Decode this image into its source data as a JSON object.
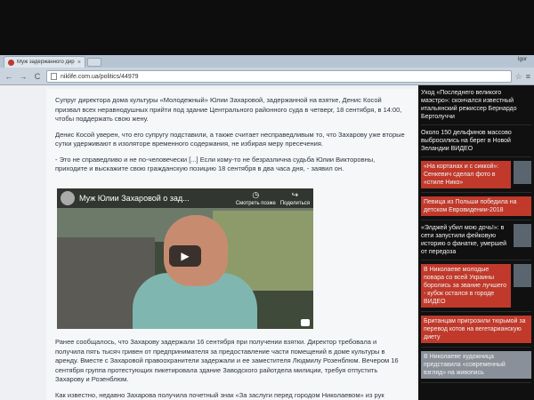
{
  "browser": {
    "tab_title": "Муж задержанного директ",
    "tab_close": "×",
    "user": "Igor",
    "url": "niklife.com.ua/politics/44979",
    "back": "←",
    "forward": "→",
    "reload": "C",
    "star": "☆",
    "menu": "≡"
  },
  "article": {
    "paragraphs": [
      "Супруг директора дома культуры «Молодежный» Юлии Захаровой, задержанной на взятке, Денис Косой призвал всех неравнодушных прийти под здание Центрального районного суда в четверг, 18 сентября, в 14:00, чтобы поддержать свою жену.",
      "Денис Косой уверен, что его супругу подставили, а также считает несправедливым то, что Захарову уже вторые сутки удерживают в изоляторе временного содержания, не избирая меру пресечения.",
      "- Это не справедливо и не по-человечески [...] Если кому-то не безразлична судьба Юлии Викторовны, приходите и выскажите свою гражданскую позицию 18 сентября в два часа дня, - заявил он."
    ],
    "after_paragraphs": [
      "Ранее сообщалось, что Захарову задержали 16 сентября при получении взятки. Директор требовала и получила пять тысяч гривен от предпринимателя за предоставление части помещений в доме культуры в аренду. Вместе с Захаровой правоохранители задержали и ее заместителя Людмилу Розенблюм. Вечером 16 сентября группа протестующих пикетировала здание Заводского райотдела милиции, требуя отпустить Захарову и Розенблюм.",
      "Как известно, недавно Захарова получила почетный знак «За заслуги перед городом Николаевом» из рук"
    ]
  },
  "video": {
    "title": "Муж Юлии Захаровой о зад...",
    "watch_later": "Смотреть позже",
    "share": "Поделиться",
    "play": "▶"
  },
  "sidebar": {
    "items": [
      {
        "text": "Уход «Последнего великого маэстро»: скончался известный итальянский режиссер Бернардо Бертолуччи",
        "style": "plain"
      },
      {
        "text": "Около 150 дельфинов массово выбросились на берег в Новой Зеландии ВИДЕО",
        "style": "plain"
      },
      {
        "text": "«На кортанах и с сиккой»: Сенкевич сделал фото в «стиле Нико»",
        "style": "red"
      },
      {
        "text": "Певица из Польши победила на детском Евровидении-2018",
        "style": "red"
      },
      {
        "text": "«Элджей убил мою дочь!»: в сети запустили фейковую историю о фанатке, умершей от передоза",
        "style": "plain"
      },
      {
        "text": "В Николаеве молодые повара со всей Украины боролись за звание лучшего - кубок остался в городе ВИДЕО",
        "style": "red"
      },
      {
        "text": "Британцам пригрозили тюрьмой за перевод котов на вегетарианскую диету",
        "style": "red"
      },
      {
        "text": "В Николаеве художница представила «современный взгляд» на живопись",
        "style": "gray"
      }
    ]
  }
}
